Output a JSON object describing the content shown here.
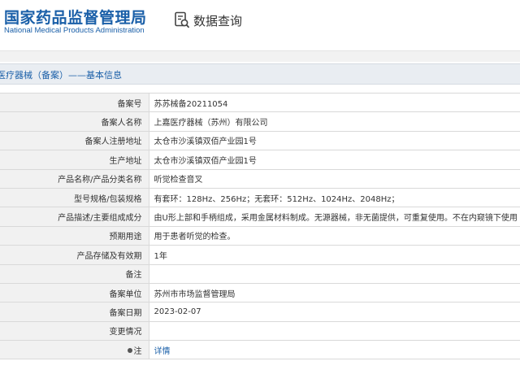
{
  "header": {
    "logo_cn": "国家药品监督管理局",
    "logo_en": "National Medical Products Administration",
    "query_label": "数据查询",
    "query_icon": "search-document-icon"
  },
  "section": {
    "title": "医疗器械（备案）——基本信息"
  },
  "rows": [
    {
      "label": "备案号",
      "value": "苏苏械备20211054"
    },
    {
      "label": "备案人名称",
      "value": "上嘉医疗器械（苏州）有限公司"
    },
    {
      "label": "备案人注册地址",
      "value": "太仓市沙溪镇双佰产业园1号"
    },
    {
      "label": "生产地址",
      "value": "太仓市沙溪镇双佰产业园1号"
    },
    {
      "label": "产品名称/产品分类名称",
      "value": "听觉检查音叉"
    },
    {
      "label": "型号规格/包装规格",
      "value": "有套环：128Hz、256Hz；无套环：512Hz、1024Hz、2048Hz；"
    },
    {
      "label": "产品描述/主要组成成分",
      "value": "由U形上部和手柄组成，采用金属材料制成。无源器械，非无菌提供，可重复使用。不在内窥镜下使用"
    },
    {
      "label": "预期用途",
      "value": "用于患者听觉的检查。"
    },
    {
      "label": "产品存储及有效期",
      "value": "1年"
    },
    {
      "label": "备注",
      "value": ""
    },
    {
      "label": "备案单位",
      "value": "苏州市市场监督管理局"
    },
    {
      "label": "备案日期",
      "value": "2023-02-07"
    },
    {
      "label": "变更情况",
      "value": ""
    },
    {
      "label": "注",
      "value": "详情"
    }
  ],
  "colors": {
    "brand": "#1a5fa8",
    "label_bg": "#f1f1f1",
    "section_bg": "#e9edf2"
  }
}
